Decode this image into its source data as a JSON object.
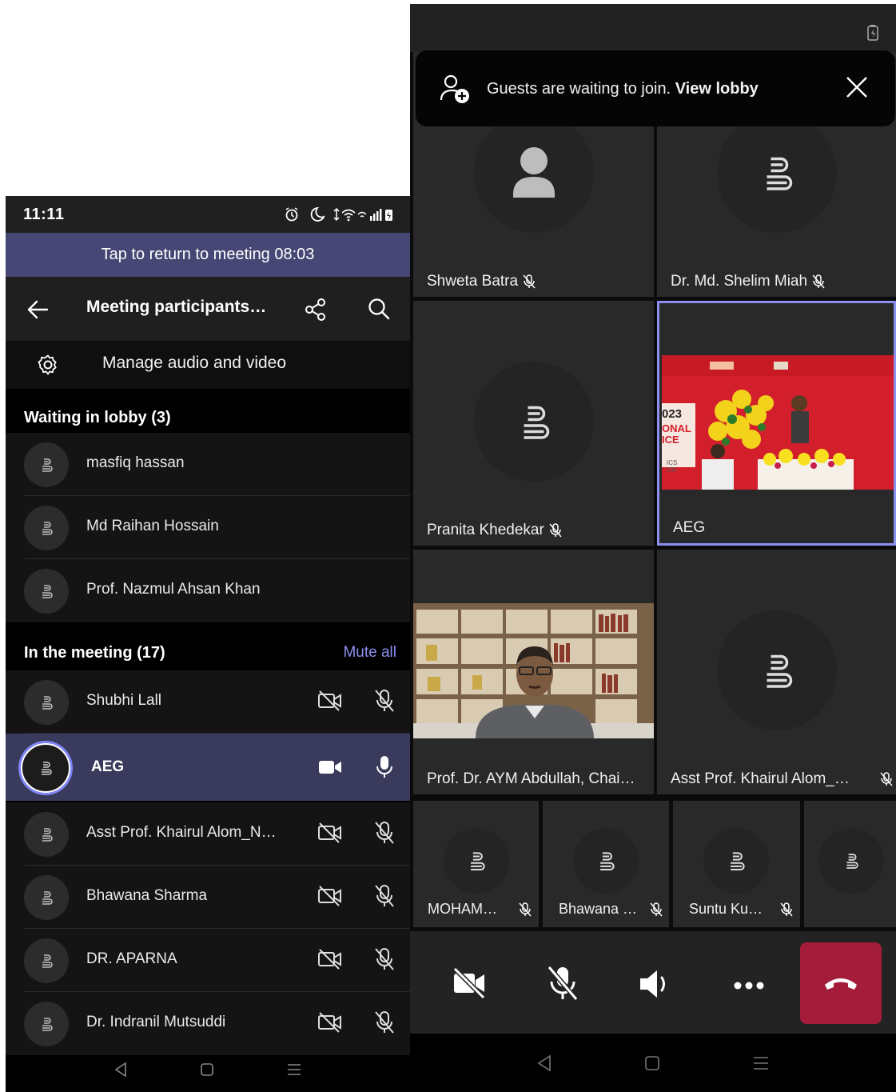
{
  "left_phone": {
    "status_bar": {
      "time": "11:11"
    },
    "return_banner": "Tap to return to meeting 08:03",
    "header": {
      "title": "Meeting participants…"
    },
    "manage_label": "Manage audio and video",
    "lobby": {
      "heading": "Waiting in lobby (3)",
      "people": [
        "masfiq hassan",
        "Md Raihan Hossain",
        "Prof. Nazmul Ahsan Khan"
      ]
    },
    "meeting": {
      "heading": "In the meeting (17)",
      "mute_all": "Mute all",
      "people": [
        {
          "name": "Shubhi Lall",
          "video": "off",
          "mic": "muted"
        },
        {
          "name": "AEG",
          "video": "on",
          "mic": "on",
          "active": true
        },
        {
          "name": "Asst Prof. Khairul Alom_N…",
          "video": "off",
          "mic": "muted"
        },
        {
          "name": "Bhawana Sharma",
          "video": "off",
          "mic": "muted"
        },
        {
          "name": "DR. APARNA",
          "video": "off",
          "mic": "muted"
        },
        {
          "name": "Dr. Indranil Mutsuddi",
          "video": "off",
          "mic": "muted"
        }
      ]
    }
  },
  "right_phone": {
    "toast": {
      "message": "Guests are waiting to join.",
      "link": "View lobby"
    },
    "tiles": {
      "t1": "Shweta Batra",
      "t2": "Dr. Md. Shelim Miah",
      "t3": "Pranita Khedekar",
      "t4": "AEG",
      "t5": "Prof. Dr. AYM Abdullah, Chai…",
      "t6": "Asst Prof. Khairul Alom_…",
      "t7": "MOHAM…",
      "t8": "Bhawana …",
      "t9": "Suntu Ku…"
    },
    "video_banner_text": [
      "023",
      "ONAL",
      "ICE",
      "ICS",
      "ON"
    ]
  },
  "colors": {
    "accent": "#7F85F5",
    "banner": "#464775",
    "hangup": "#A31D3A"
  }
}
